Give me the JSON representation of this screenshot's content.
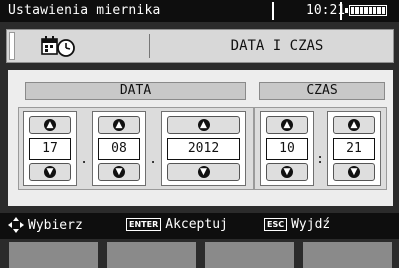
{
  "topbar": {
    "title": "Ustawienia miernika",
    "time": "10:21"
  },
  "header": {
    "title": "DATA I CZAS",
    "icon": "clock-calendar-icon"
  },
  "date": {
    "label": "DATA",
    "day": "17",
    "month": "08",
    "year": "2012",
    "separator": "."
  },
  "time": {
    "label": "CZAS",
    "hour": "10",
    "minute": "21",
    "separator": ":"
  },
  "hints": {
    "select_label": "Wybierz",
    "enter_key": "ENTER",
    "enter_label": "Akceptuj",
    "esc_key": "ESC",
    "esc_label": "Wyjdź"
  },
  "colors": {
    "status_bar": "#0e0e0e",
    "panel": "#ededed",
    "softkey": "#8a8a8a",
    "background": "#2b2b2b"
  }
}
